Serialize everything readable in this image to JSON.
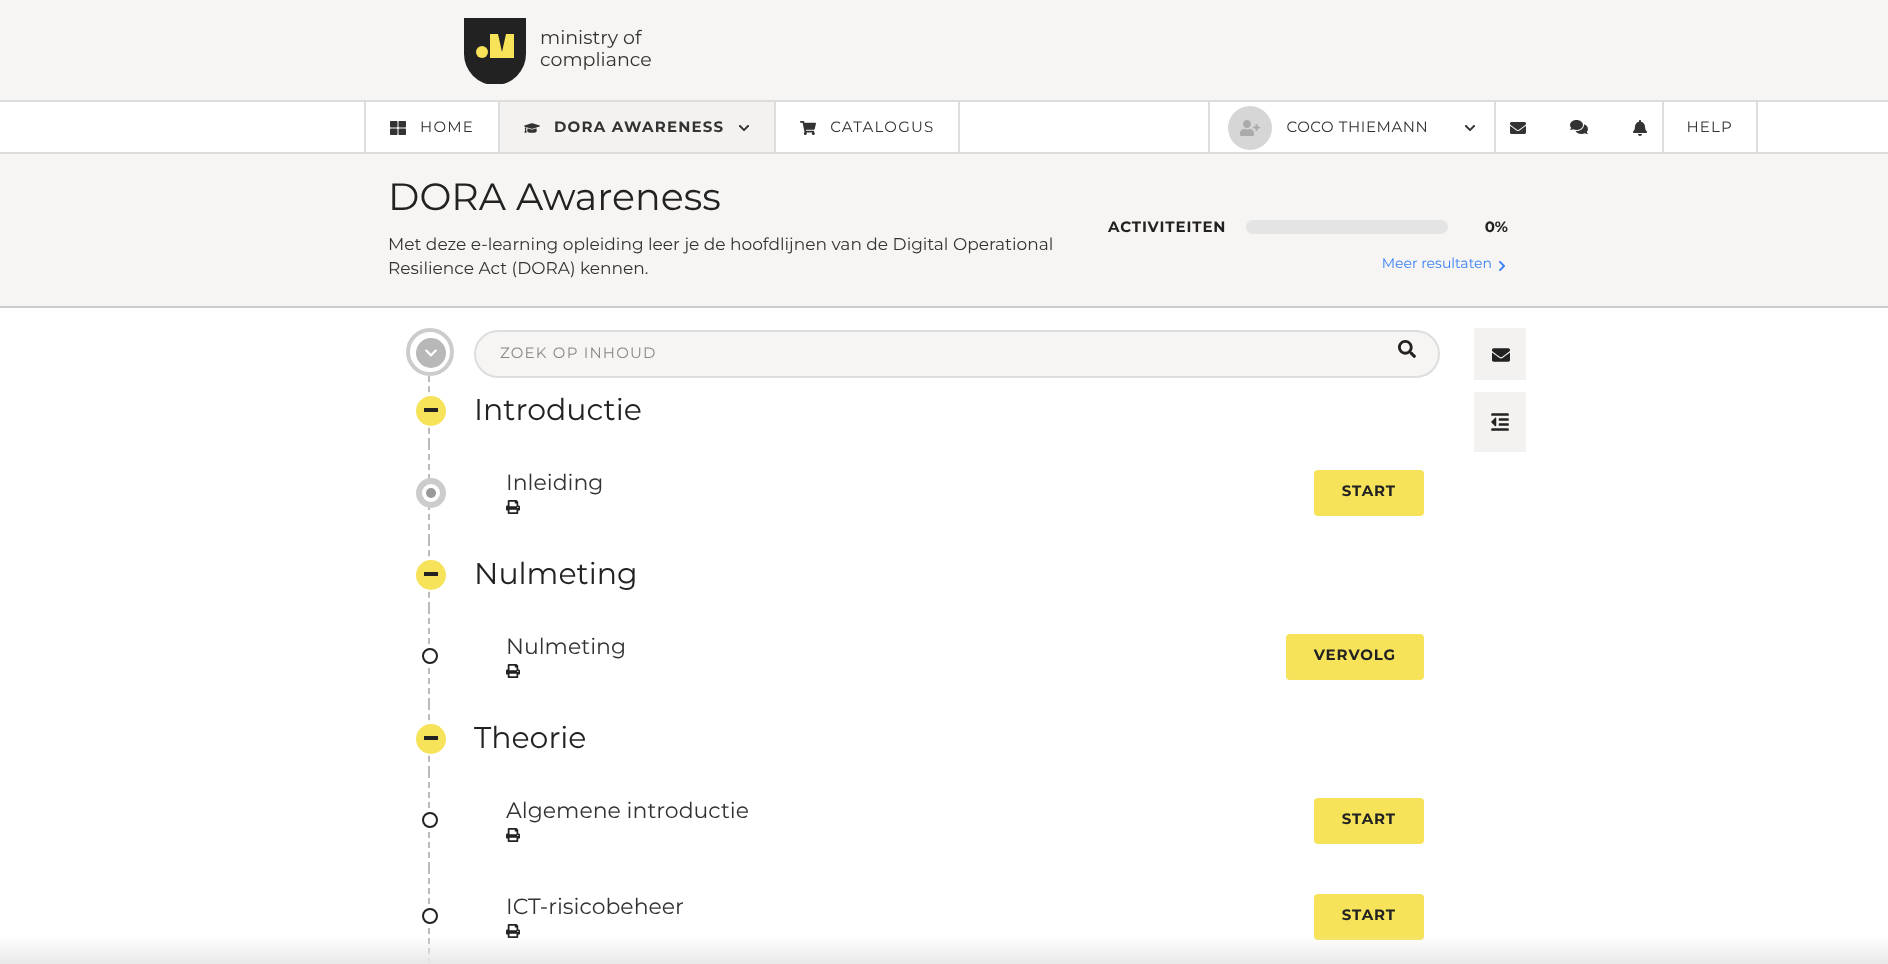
{
  "logo": {
    "text": "ministry of compliance"
  },
  "nav": [
    {
      "label": "HOME",
      "selected": false,
      "caret": false
    },
    {
      "label": "DORA AWARENESS",
      "selected": true,
      "caret": true
    },
    {
      "label": "CATALOGUS",
      "selected": false,
      "caret": false
    }
  ],
  "user": {
    "name": "COCO THIEMANN"
  },
  "help": "HELP",
  "course": {
    "title": "DORA Awareness",
    "description": "Met deze e-learning opleiding leer je de hoofdlijnen van de Digital Operational Resilience Act (DORA) kennen.",
    "progress_label": "ACTIVITEITEN",
    "level": 0,
    "reading": "0%",
    "more_link": "Meer resultaten"
  },
  "search": {
    "placeholder": "ZOEK OP INHOUD"
  },
  "sections": [
    {
      "title": "Introductie",
      "expanded": true,
      "children": [
        {
          "title": "Inleiding",
          "current": true,
          "button": "START"
        }
      ]
    },
    {
      "title": "Nulmeting",
      "expanded": true,
      "children": [
        {
          "title": "Nulmeting",
          "current": false,
          "button": "VERVOLG"
        }
      ]
    },
    {
      "title": "Theorie",
      "expanded": true,
      "children": [
        {
          "title": "Algemene introductie",
          "current": false,
          "button": "START"
        },
        {
          "title": "ICT-risicobeheer",
          "current": false,
          "button": "START"
        }
      ]
    }
  ]
}
